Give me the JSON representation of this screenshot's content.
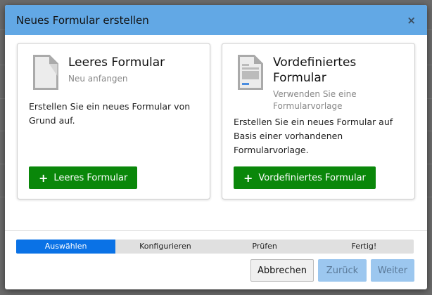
{
  "dialog": {
    "title": "Neues Formular erstellen",
    "close_label": "×",
    "cards": [
      {
        "title": "Leeres Formular",
        "subtitle": "Neu anfangen",
        "description": "Erstellen Sie ein neues Formular von Grund auf.",
        "button": "Leeres Formular",
        "icon": "blank-document-icon"
      },
      {
        "title": "Vordefiniertes Formular",
        "subtitle": "Verwenden Sie eine Formularvorlage",
        "description": "Erstellen Sie ein neues Formular auf Basis einer vorhandenen Formularvorlage.",
        "button": "Vordefiniertes Formular",
        "icon": "template-document-icon"
      }
    ],
    "steps": [
      "Auswählen",
      "Konfigurieren",
      "Prüfen",
      "Fertig!"
    ],
    "active_step": 0,
    "footer": {
      "cancel": "Abbrechen",
      "back": "Zurück",
      "next": "Weiter"
    }
  },
  "colors": {
    "header": "#62a8e5",
    "primary_button": "#0a870a",
    "active_step": "#0a72e6",
    "disabled_button": "#9cc7ef"
  }
}
